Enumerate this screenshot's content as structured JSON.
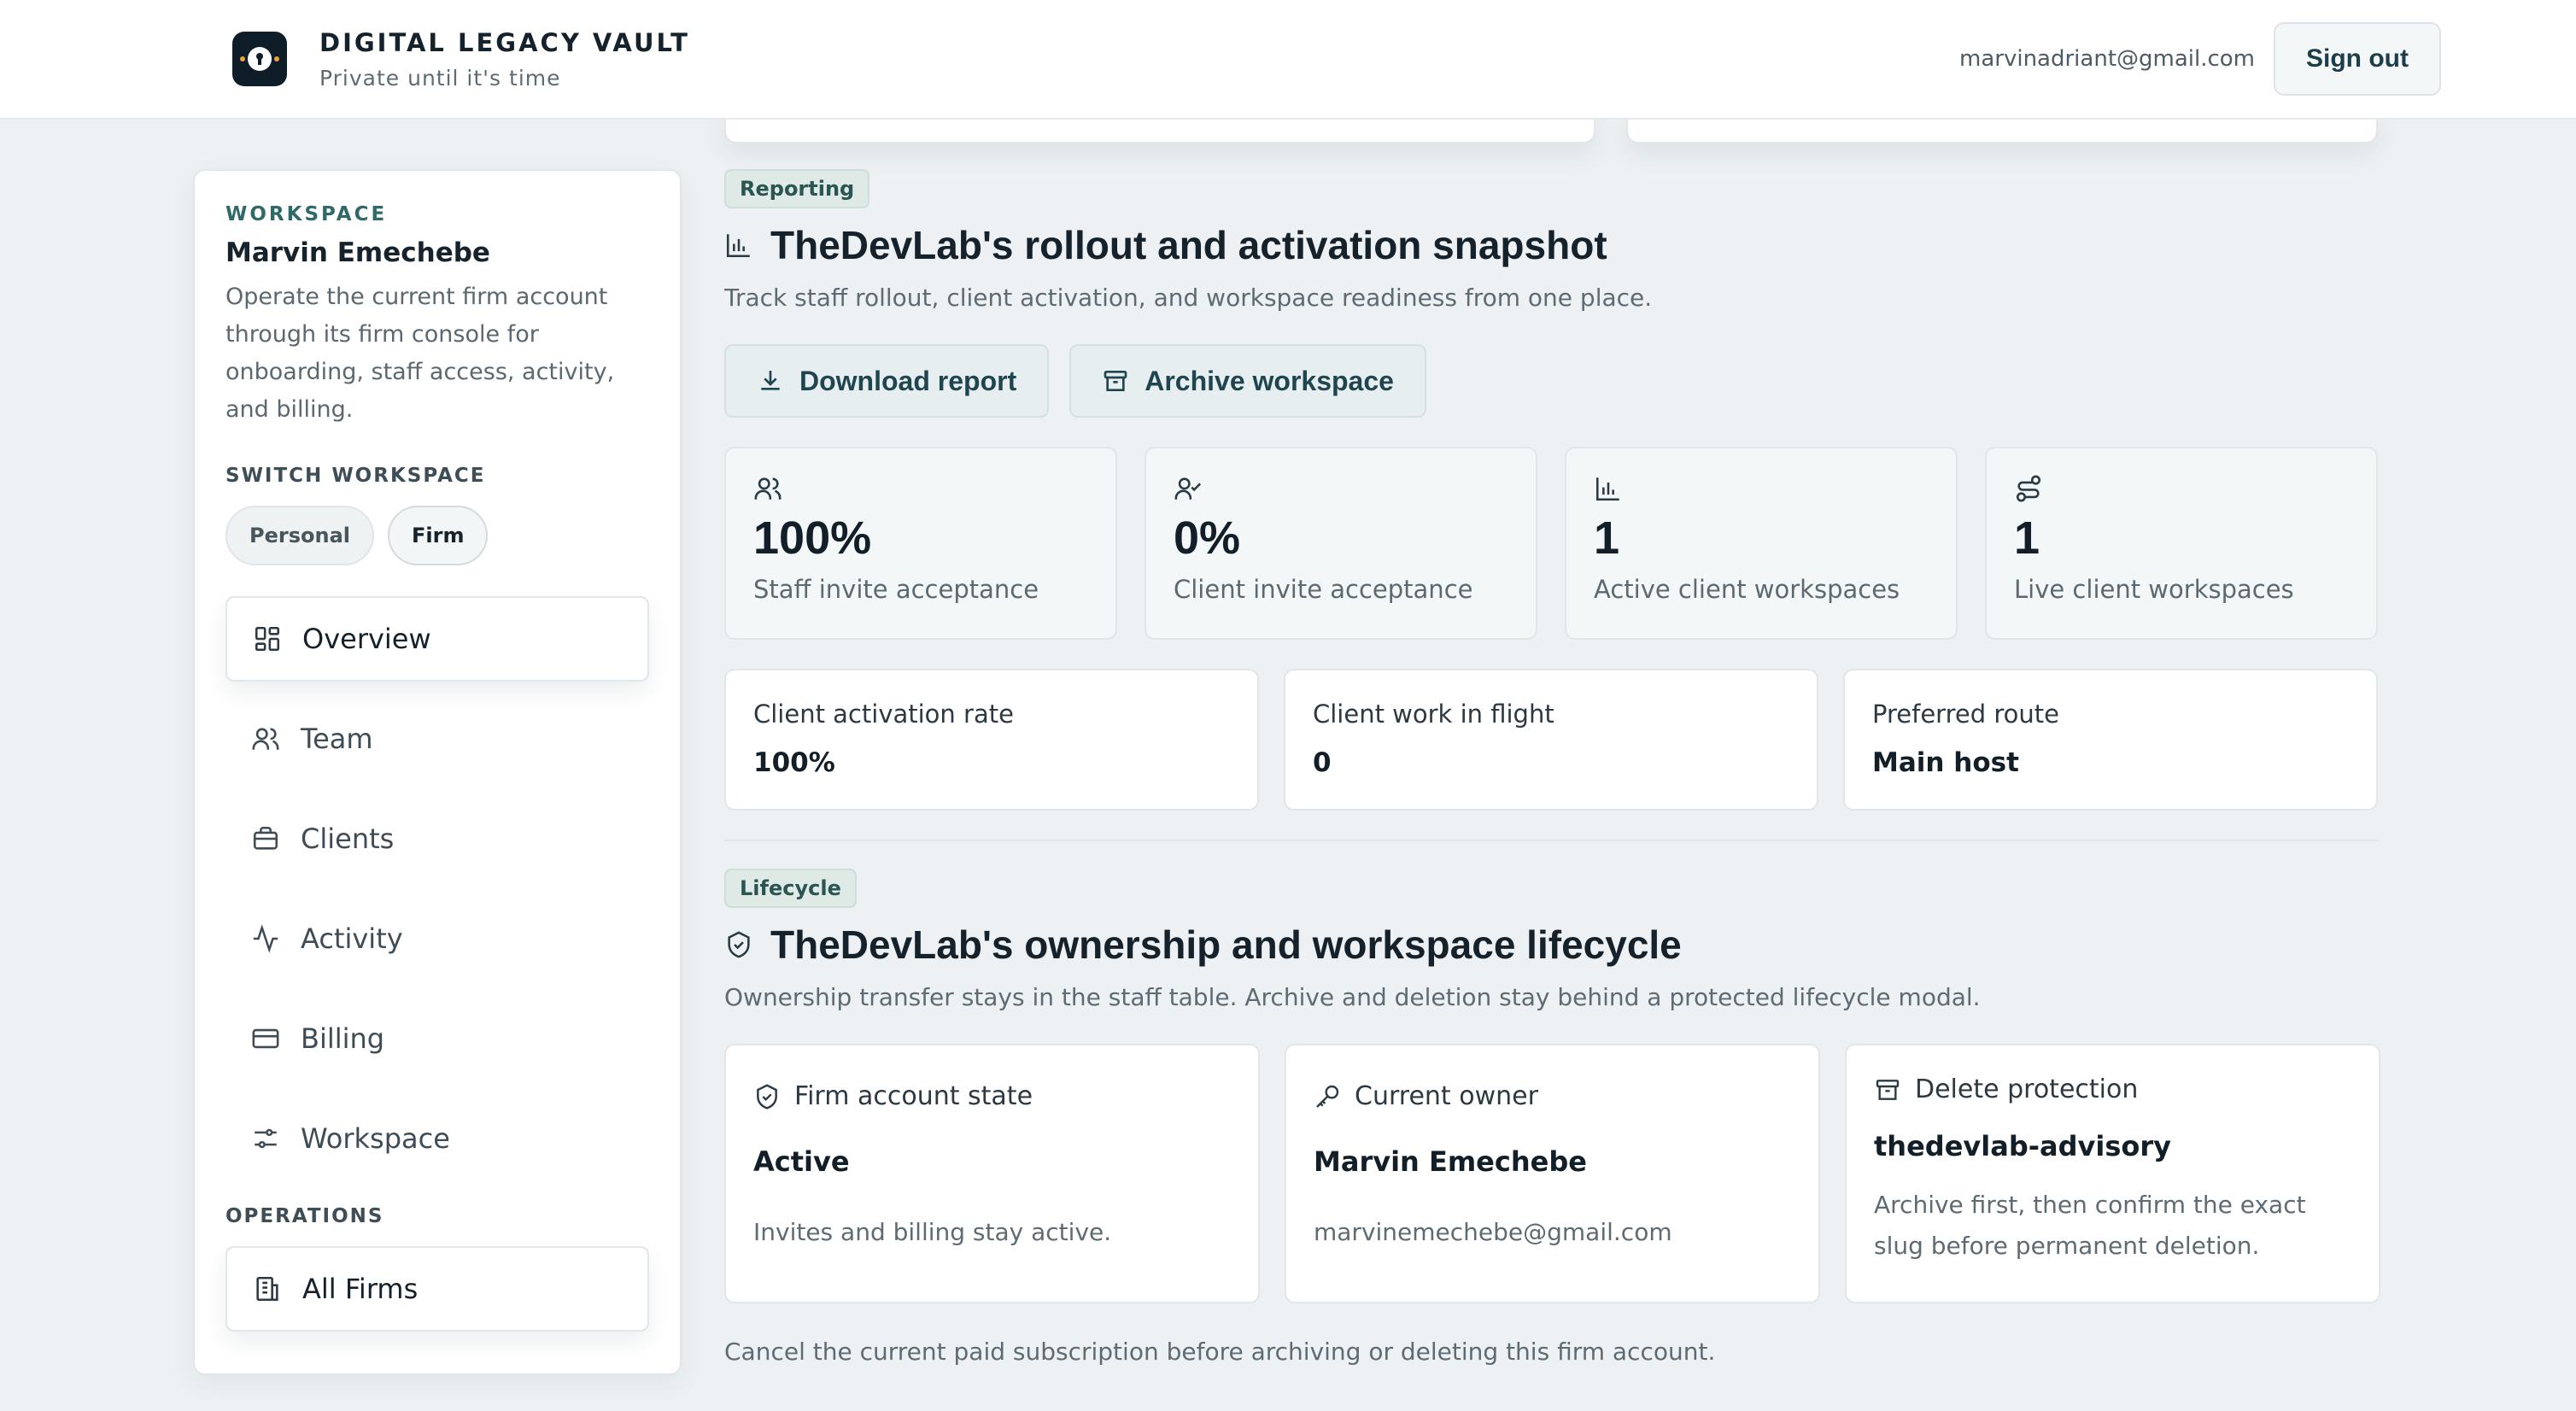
{
  "header": {
    "brand_title": "DIGITAL LEGACY VAULT",
    "brand_subtitle": "Private until it's time",
    "user_email": "marvinadriant@gmail.com",
    "sign_out_label": "Sign out"
  },
  "sidebar": {
    "eyebrow": "WORKSPACE",
    "name": "Marvin Emechebe",
    "description": "Operate the current firm account through its firm console for onboarding, staff access, activity, and billing.",
    "switch_heading": "SWITCH WORKSPACE",
    "switch_options": [
      "Personal",
      "Firm"
    ],
    "active_switch": "Firm",
    "nav_items": [
      "Overview",
      "Team",
      "Clients",
      "Activity",
      "Billing",
      "Workspace"
    ],
    "active_nav": "Overview",
    "operations_heading": "OPERATIONS",
    "operations_items": [
      "All Firms"
    ]
  },
  "reporting": {
    "tag": "Reporting",
    "title": "TheDevLab's rollout and activation snapshot",
    "subtitle": "Track staff rollout, client activation, and workspace readiness from one place.",
    "download_label": "Download report",
    "archive_label": "Archive workspace",
    "stats": [
      {
        "icon": "users-icon",
        "value": "100%",
        "label": "Staff invite acceptance"
      },
      {
        "icon": "user-check-icon",
        "value": "0%",
        "label": "Client invite acceptance"
      },
      {
        "icon": "bar-chart-icon",
        "value": "1",
        "label": "Active client workspaces"
      },
      {
        "icon": "route-icon",
        "value": "1",
        "label": "Live client workspaces"
      }
    ],
    "metrics": [
      {
        "label": "Client activation rate",
        "value": "100%"
      },
      {
        "label": "Client work in flight",
        "value": "0"
      },
      {
        "label": "Preferred route",
        "value": "Main host"
      }
    ]
  },
  "lifecycle": {
    "tag": "Lifecycle",
    "title": "TheDevLab's ownership and workspace lifecycle",
    "subtitle": "Ownership transfer stays in the staff table. Archive and deletion stay behind a protected lifecycle modal.",
    "cards": [
      {
        "icon": "shield-check-icon",
        "label": "Firm account state",
        "value": "Active",
        "note": "Invites and billing stay active."
      },
      {
        "icon": "key-icon",
        "label": "Current owner",
        "value": "Marvin Emechebe",
        "note": "marvinemechebe@gmail.com"
      },
      {
        "icon": "archive-icon",
        "label": "Delete protection",
        "value": "thedevlab-advisory",
        "note": "Archive first, then confirm the exact slug before permanent deletion."
      }
    ],
    "footnote": "Cancel the current paid subscription before archiving or deleting this firm account."
  },
  "colors": {
    "accent": "#2f6a68",
    "background": "#edf1f3",
    "text_dark": "#16222b"
  }
}
